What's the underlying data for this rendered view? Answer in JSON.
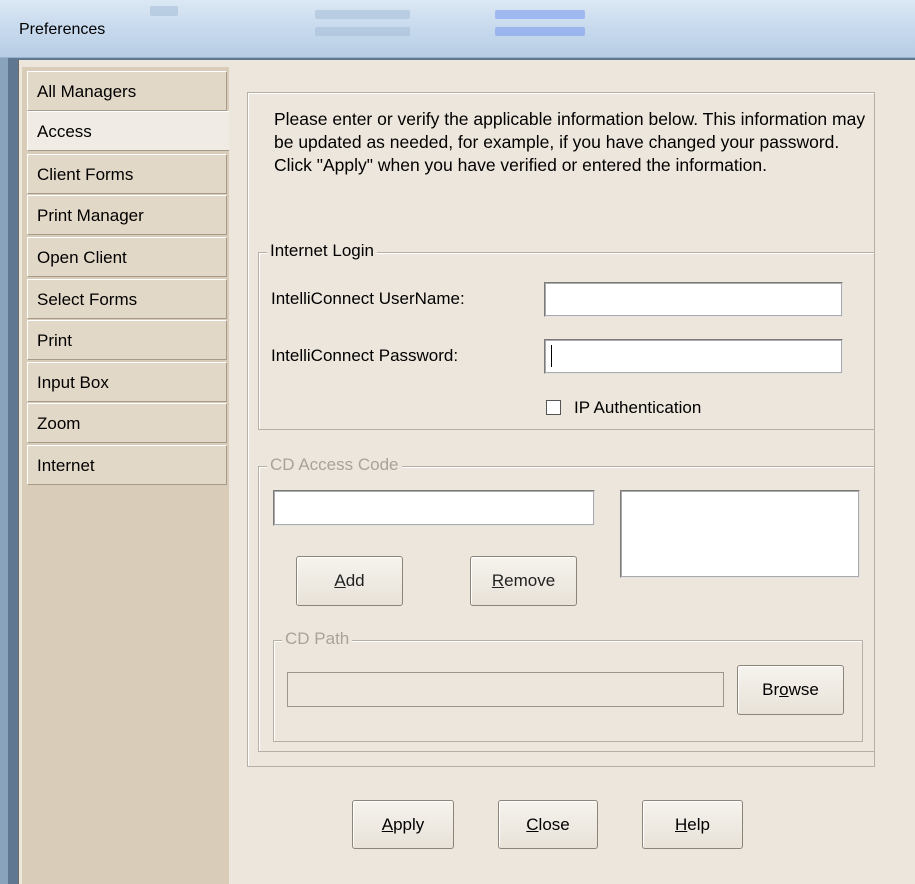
{
  "window": {
    "title": "Preferences"
  },
  "tabs": [
    {
      "label": "All Managers",
      "active": false
    },
    {
      "label": "Access",
      "active": true
    },
    {
      "label": "Client Forms",
      "active": false
    },
    {
      "label": "Print Manager",
      "active": false
    },
    {
      "label": "Open Client",
      "active": false
    },
    {
      "label": "Select Forms",
      "active": false
    },
    {
      "label": "Print",
      "active": false
    },
    {
      "label": "Input Box",
      "active": false
    },
    {
      "label": "Zoom",
      "active": false
    },
    {
      "label": "Internet",
      "active": false
    }
  ],
  "intro": "Please enter or verify the applicable information below. This information may be updated as needed, for example, if you have changed your password. Click \"Apply\"  when you have verified or entered the information.",
  "internet_login": {
    "legend": "Internet Login",
    "username_label": "IntelliConnect UserName:",
    "username_value": "",
    "password_label": "IntelliConnect Password:",
    "password_value": "",
    "ip_auth_label": "IP Authentication",
    "ip_auth_checked": false
  },
  "cd_access": {
    "legend": "CD Access Code",
    "code_value": "",
    "add_label_u": "A",
    "add_label_rest": "dd",
    "remove_label_u": "R",
    "remove_label_rest": "emove",
    "cd_path": {
      "legend": "CD Path",
      "path_value": "",
      "browse_pre": "Br",
      "browse_u": "o",
      "browse_post": "wse"
    }
  },
  "footer": {
    "apply_u": "A",
    "apply_rest": "pply",
    "close_u": "C",
    "close_rest": "lose",
    "help_u": "H",
    "help_rest": "elp"
  }
}
